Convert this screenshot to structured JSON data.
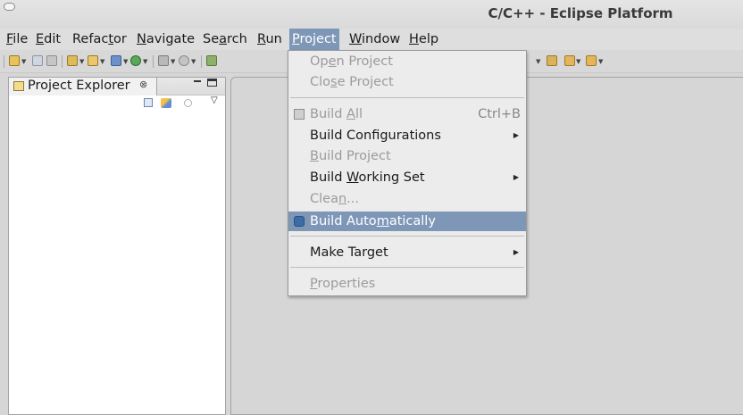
{
  "window": {
    "title": "C/C++ - Eclipse Platform"
  },
  "menubar": {
    "items": [
      {
        "label": "File"
      },
      {
        "label": "Edit"
      },
      {
        "label": "Refactor"
      },
      {
        "label": "Navigate"
      },
      {
        "label": "Search"
      },
      {
        "label": "Run"
      },
      {
        "label": "Project"
      },
      {
        "label": "Window"
      },
      {
        "label": "Help"
      }
    ]
  },
  "explorer": {
    "tab_label": "Project Explorer",
    "tab_close_glyph": "⊗"
  },
  "project_menu": {
    "items": [
      {
        "label": "Open Project",
        "state": "disabled"
      },
      {
        "label": "Close Project",
        "state": "disabled"
      },
      {
        "label": "Build All",
        "accelerator": "Ctrl+B",
        "state": "disabled",
        "icon": "build-all-icon"
      },
      {
        "label": "Build Configurations",
        "state": "enabled",
        "submenu": true
      },
      {
        "label": "Build Project",
        "state": "disabled"
      },
      {
        "label": "Build Working Set",
        "state": "enabled",
        "submenu": true
      },
      {
        "label": "Clean...",
        "state": "disabled"
      },
      {
        "label": "Build Automatically",
        "state": "highlighted",
        "checked": true,
        "icon": "checkbox-checked-icon"
      },
      {
        "label": "Make Target",
        "state": "enabled",
        "submenu": true
      },
      {
        "label": "Properties",
        "state": "disabled"
      }
    ]
  },
  "colors": {
    "highlight": "#7e97b7",
    "disabled_text": "#9b9b9b"
  }
}
